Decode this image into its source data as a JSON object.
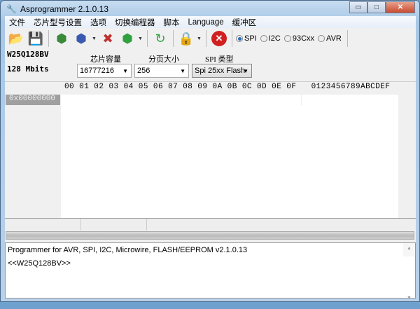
{
  "window": {
    "title": "Asprogrammer 2.1.0.13",
    "min": "▭",
    "max": "□",
    "close": "✕"
  },
  "menu": [
    "文件",
    "芯片型号设置",
    "选项",
    "切换编程器",
    "脚本",
    "Language",
    "缓冲区"
  ],
  "toolbar": {
    "protocols": [
      "SPI",
      "I2C",
      "93Cxx",
      "AVR"
    ],
    "selected": "SPI"
  },
  "chip": {
    "name": "W25Q128BV",
    "size": "128 Mbits"
  },
  "fields": {
    "capacity_label": "芯片容量",
    "capacity": "16777216",
    "page_label": "分页大小",
    "page": "256",
    "spi_label": "SPI 类型",
    "spi": "Spi 25xx Flash"
  },
  "hex": {
    "header": "00 01 02 03 04 05 06 07 08 09 0A 0B 0C 0D 0E 0F",
    "ascii_header": "0123456789ABCDEF",
    "address": "0x00000000"
  },
  "log": [
    "Programmer for AVR, SPI, I2C, Microwire, FLASH/EEPROM v2.1.0.13",
    "<<W25Q128BV>>"
  ]
}
